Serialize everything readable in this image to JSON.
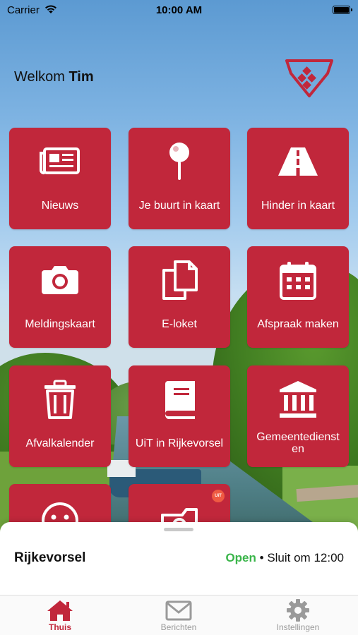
{
  "status_bar": {
    "carrier": "Carrier",
    "time": "10:00 AM"
  },
  "header": {
    "welcome": "Welkom",
    "user": "Tim"
  },
  "tiles": [
    {
      "label": "Nieuws",
      "icon": "newspaper-icon"
    },
    {
      "label": "Je buurt in kaart",
      "icon": "map-pin-icon"
    },
    {
      "label": "Hinder in kaart",
      "icon": "road-icon"
    },
    {
      "label": "Meldingskaart",
      "icon": "camera-icon"
    },
    {
      "label": "E-loket",
      "icon": "documents-icon"
    },
    {
      "label": "Afspraak maken",
      "icon": "calendar-icon"
    },
    {
      "label": "Afvalkalender",
      "icon": "trash-icon"
    },
    {
      "label": "UiT in Rijkevorsel",
      "icon": "book-icon"
    },
    {
      "label": "Gemeentediensten",
      "label_line1": "Gemeentedienst",
      "label_line2": "en",
      "icon": "town-hall-icon"
    },
    {
      "label": "",
      "icon": "smiley-icon"
    },
    {
      "label": "",
      "icon": "photo-frame-icon",
      "badge": "UiT"
    }
  ],
  "sheet": {
    "town": "Rijkevorsel",
    "status": "Open",
    "separator": "•",
    "closing": "Sluit om 12:00"
  },
  "tabbar": {
    "tabs": [
      {
        "label": "Thuis",
        "icon": "home-icon",
        "active": true
      },
      {
        "label": "Berichten",
        "icon": "mail-icon",
        "active": false
      },
      {
        "label": "Instellingen",
        "icon": "gear-icon",
        "active": false
      }
    ]
  },
  "colors": {
    "brand_red": "#c1273b",
    "open_green": "#3ab54a",
    "inactive_gray": "#9a9a9a"
  }
}
